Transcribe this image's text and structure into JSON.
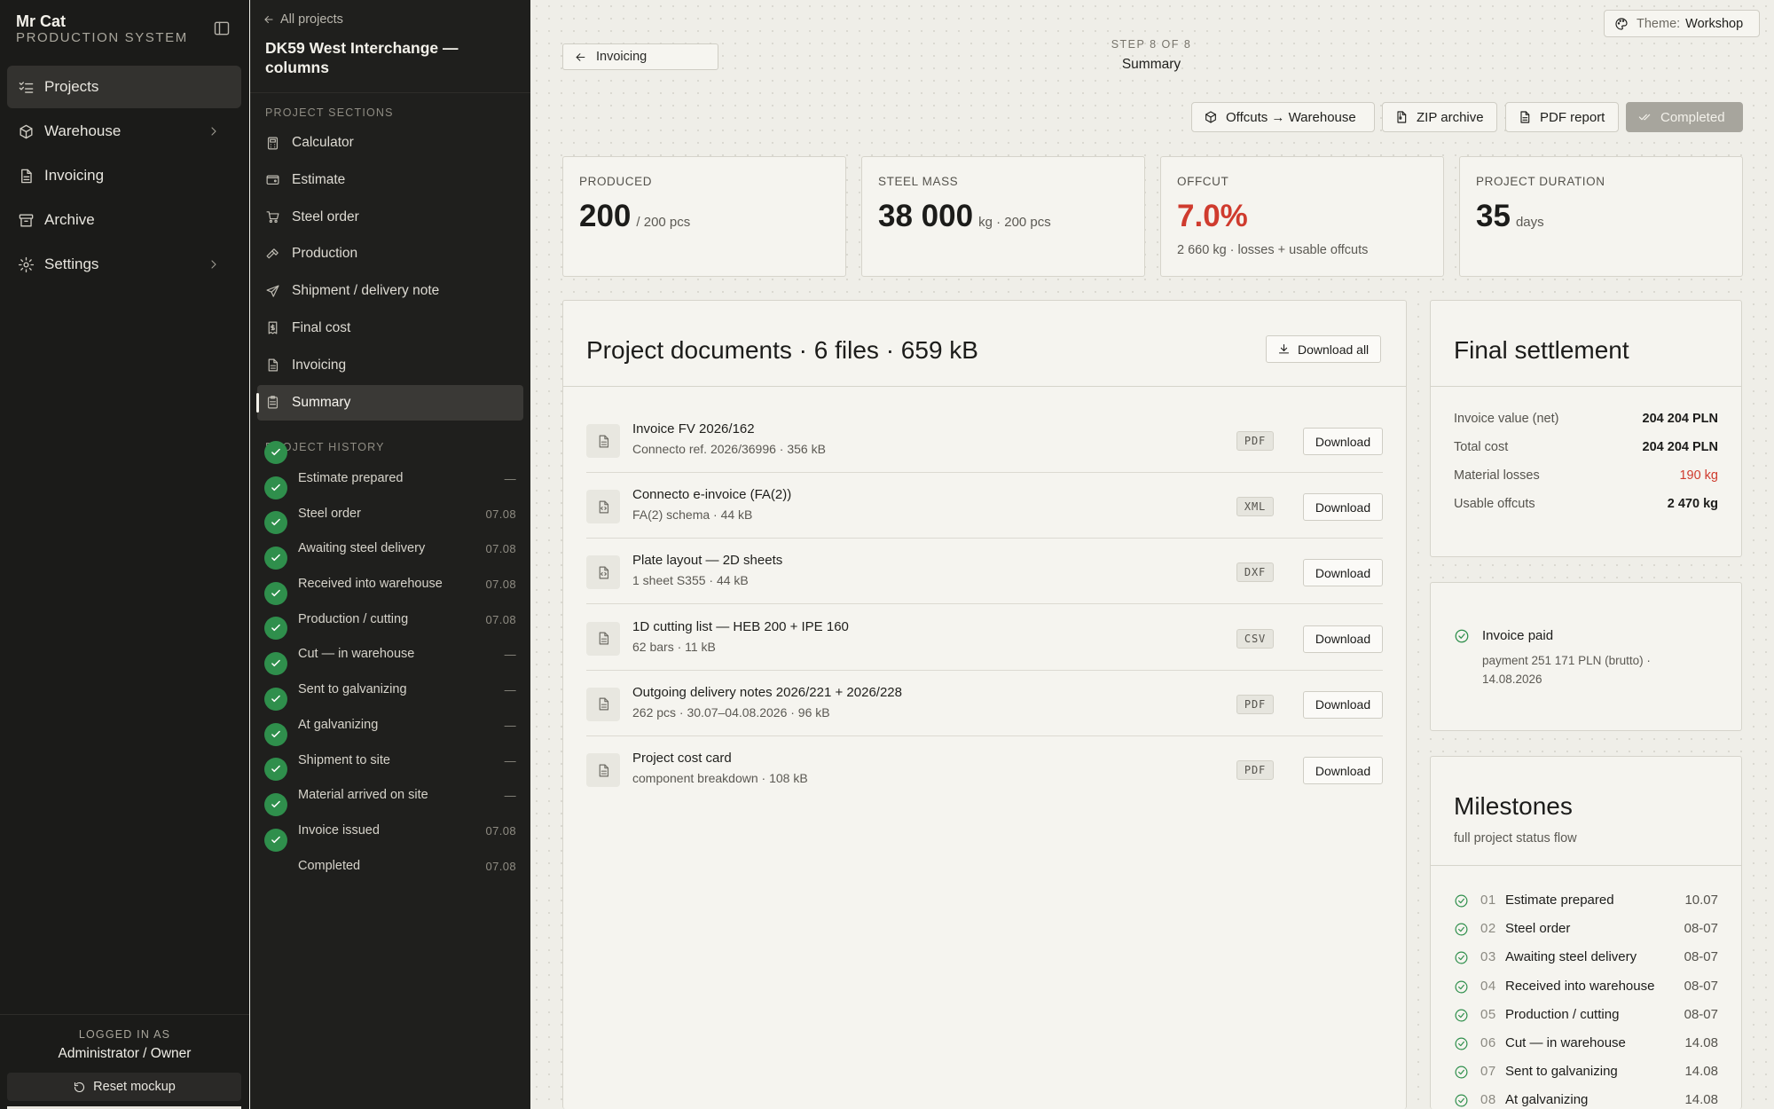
{
  "app": {
    "name": "Mr Cat",
    "subtitle": "PRODUCTION SYSTEM"
  },
  "nav": {
    "items": [
      {
        "label": "Projects",
        "icon": "list-check-icon",
        "active": true
      },
      {
        "label": "Warehouse",
        "icon": "box-icon",
        "has_submenu": true
      },
      {
        "label": "Invoicing",
        "icon": "document-icon"
      },
      {
        "label": "Archive",
        "icon": "archive-icon"
      },
      {
        "label": "Settings",
        "icon": "gear-icon",
        "has_submenu": true
      }
    ],
    "footer": {
      "logged_label": "LOGGED IN AS",
      "user": "Administrator / Owner",
      "reset_label": "Reset mockup"
    }
  },
  "project": {
    "back_label": "All projects",
    "title": "DK59 West Interchange — columns",
    "sections_label": "PROJECT SECTIONS",
    "sections": [
      {
        "label": "Calculator",
        "icon": "calculator-icon"
      },
      {
        "label": "Estimate",
        "icon": "wallet-icon"
      },
      {
        "label": "Steel order",
        "icon": "cart-icon"
      },
      {
        "label": "Production",
        "icon": "hammer-icon"
      },
      {
        "label": "Shipment / delivery note",
        "icon": "send-icon"
      },
      {
        "label": "Final cost",
        "icon": "receipt-icon"
      },
      {
        "label": "Invoicing",
        "icon": "document-icon"
      },
      {
        "label": "Summary",
        "icon": "clipboard-icon",
        "active": true
      }
    ],
    "history_label": "PROJECT HISTORY",
    "history": [
      {
        "label": "Estimate prepared",
        "date": "—"
      },
      {
        "label": "Steel order",
        "date": "07.08"
      },
      {
        "label": "Awaiting steel delivery",
        "date": "07.08"
      },
      {
        "label": "Received into warehouse",
        "date": "07.08"
      },
      {
        "label": "Production / cutting",
        "date": "07.08"
      },
      {
        "label": "Cut — in warehouse",
        "date": "—"
      },
      {
        "label": "Sent to galvanizing",
        "date": "—"
      },
      {
        "label": "At galvanizing",
        "date": "—"
      },
      {
        "label": "Shipment to site",
        "date": "—"
      },
      {
        "label": "Material arrived on site",
        "date": "—"
      },
      {
        "label": "Invoice issued",
        "date": "07.08"
      },
      {
        "label": "Completed",
        "date": "07.08"
      }
    ]
  },
  "header": {
    "back_label": "Invoicing",
    "step": "STEP 8 OF 8",
    "step_name": "Summary",
    "theme_label": "Theme:",
    "theme_value": "Workshop",
    "actions": {
      "offcuts": "Offcuts → Warehouse",
      "zip": "ZIP archive",
      "pdf": "PDF report",
      "completed": "Completed"
    }
  },
  "stats": [
    {
      "label": "PRODUCED",
      "value": "200",
      "unit": "/ 200 pcs",
      "note": ""
    },
    {
      "label": "STEEL MASS",
      "value": "38 000",
      "unit": "kg · 200 pcs",
      "note": ""
    },
    {
      "label": "OFFCUT",
      "value": "7.0%",
      "unit": "",
      "note": "2 660 kg · losses + usable offcuts",
      "color": "#cf3b2e"
    },
    {
      "label": "PROJECT DURATION",
      "value": "35",
      "unit": "days",
      "note": ""
    }
  ],
  "documents": {
    "title": "Project documents · 6 files · 659 kB",
    "download_all": "Download all",
    "download_label": "Download",
    "files": [
      {
        "name": "Invoice FV 2026/162",
        "meta": "Connecto ref. 2026/36996 · 356 kB",
        "type": "PDF",
        "icon": "document-icon"
      },
      {
        "name": "Connecto e-invoice (FA(2))",
        "meta": "FA(2) schema · 44 kB",
        "type": "XML",
        "icon": "code-file-icon"
      },
      {
        "name": "Plate layout — 2D sheets",
        "meta": "1 sheet S355 · 44 kB",
        "type": "DXF",
        "icon": "code-file-icon"
      },
      {
        "name": "1D cutting list — HEB 200 + IPE 160",
        "meta": "62 bars · 11 kB",
        "type": "CSV",
        "icon": "document-icon"
      },
      {
        "name": "Outgoing delivery notes 2026/221 + 2026/228",
        "meta": "262 pcs · 30.07–04.08.2026 · 96 kB",
        "type": "PDF",
        "icon": "document-icon"
      },
      {
        "name": "Project cost card",
        "meta": "component breakdown · 108 kB",
        "type": "PDF",
        "icon": "document-icon"
      }
    ]
  },
  "settlement": {
    "title": "Final settlement",
    "rows": [
      {
        "label": "Invoice value (net)",
        "value": "204 204 PLN"
      },
      {
        "label": "Total cost",
        "value": "204 204 PLN"
      },
      {
        "label": "Material losses",
        "value": "190 kg",
        "color": "#cf3b2e"
      },
      {
        "label": "Usable offcuts",
        "value": "2 470 kg"
      }
    ]
  },
  "payment": {
    "title": "Invoice paid",
    "note": "payment 251 171 PLN (brutto) · 14.08.2026"
  },
  "milestones": {
    "title": "Milestones",
    "subtitle": "full project status flow",
    "items": [
      {
        "n": "01",
        "label": "Estimate prepared",
        "date": "10.07"
      },
      {
        "n": "02",
        "label": "Steel order",
        "date": "08-07"
      },
      {
        "n": "03",
        "label": "Awaiting steel delivery",
        "date": "08-07"
      },
      {
        "n": "04",
        "label": "Received into warehouse",
        "date": "08-07"
      },
      {
        "n": "05",
        "label": "Production / cutting",
        "date": "08-07"
      },
      {
        "n": "06",
        "label": "Cut — in warehouse",
        "date": "14.08"
      },
      {
        "n": "07",
        "label": "Sent to galvanizing",
        "date": "14.08"
      },
      {
        "n": "08",
        "label": "At galvanizing",
        "date": "14.08"
      }
    ]
  }
}
